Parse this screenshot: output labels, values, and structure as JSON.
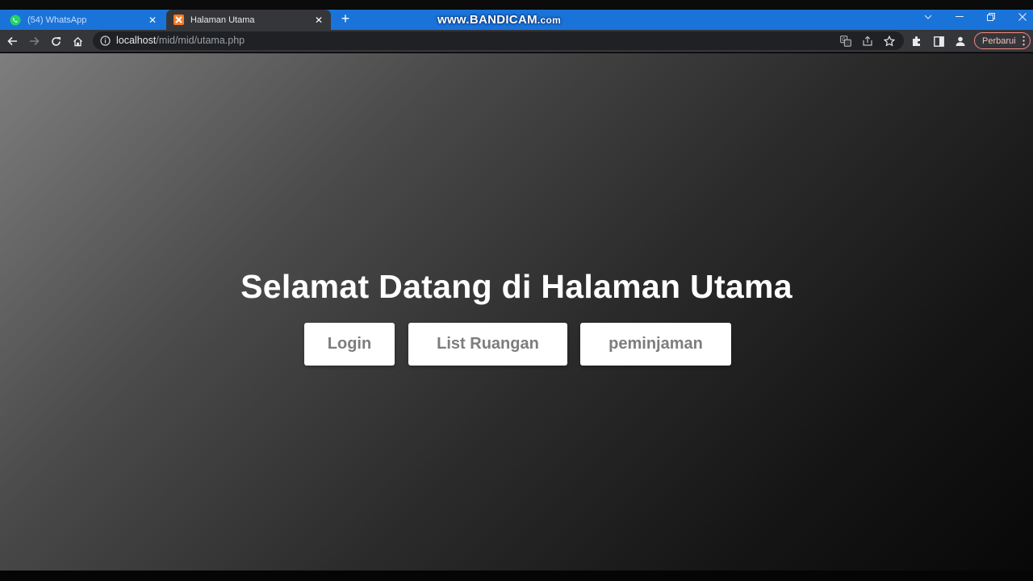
{
  "browser": {
    "tabs": [
      {
        "title": "(54) WhatsApp",
        "active": false,
        "favicon": "whatsapp-icon"
      },
      {
        "title": "Halaman Utama",
        "active": true,
        "favicon": "xampp-icon"
      }
    ],
    "address_bar": {
      "host": "localhost",
      "path": "/mid/mid/utama.php"
    },
    "update_button_label": "Perbarui"
  },
  "recording_watermark": {
    "main": "www.BANDICAM",
    "suffix": ".com"
  },
  "page": {
    "heading": "Selamat Datang di Halaman Utama",
    "buttons": [
      {
        "label": "Login"
      },
      {
        "label": "List Ruangan"
      },
      {
        "label": "peminjaman"
      }
    ]
  },
  "colors": {
    "tab_strip": "#1a73d9",
    "toolbar": "#35363a",
    "page_gradient_start": "#7e7e7e",
    "page_gradient_end": "#080808",
    "button_text": "#7d7d7d"
  }
}
